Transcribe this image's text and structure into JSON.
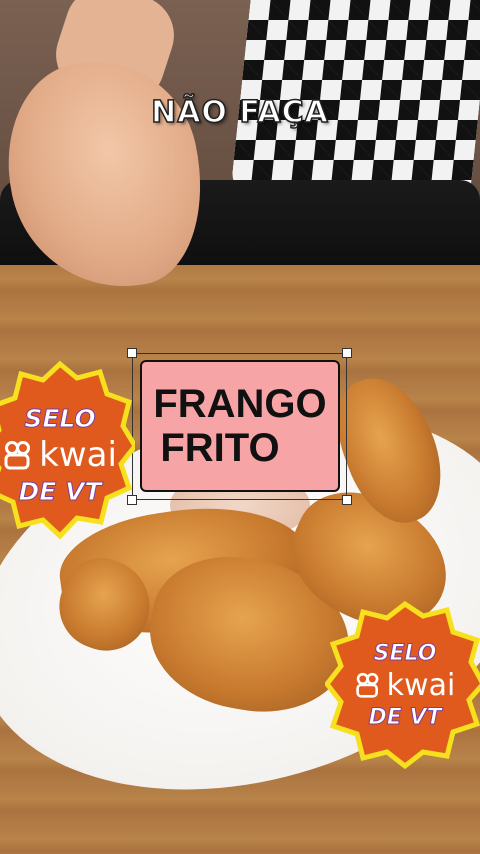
{
  "overlay": {
    "headline": "NÃO FAÇA",
    "title_line1": "FRANGO",
    "title_line2": "FRITO"
  },
  "seals": [
    {
      "top": "SELO",
      "brand": "kwai",
      "bottom": "DE VT"
    },
    {
      "top": "SELO",
      "brand": "kwai",
      "bottom": "DE VT"
    }
  ],
  "colors": {
    "seal_fill": "#e05a1e",
    "seal_border": "#f7e01e",
    "title_box": "#f7a4a6"
  }
}
